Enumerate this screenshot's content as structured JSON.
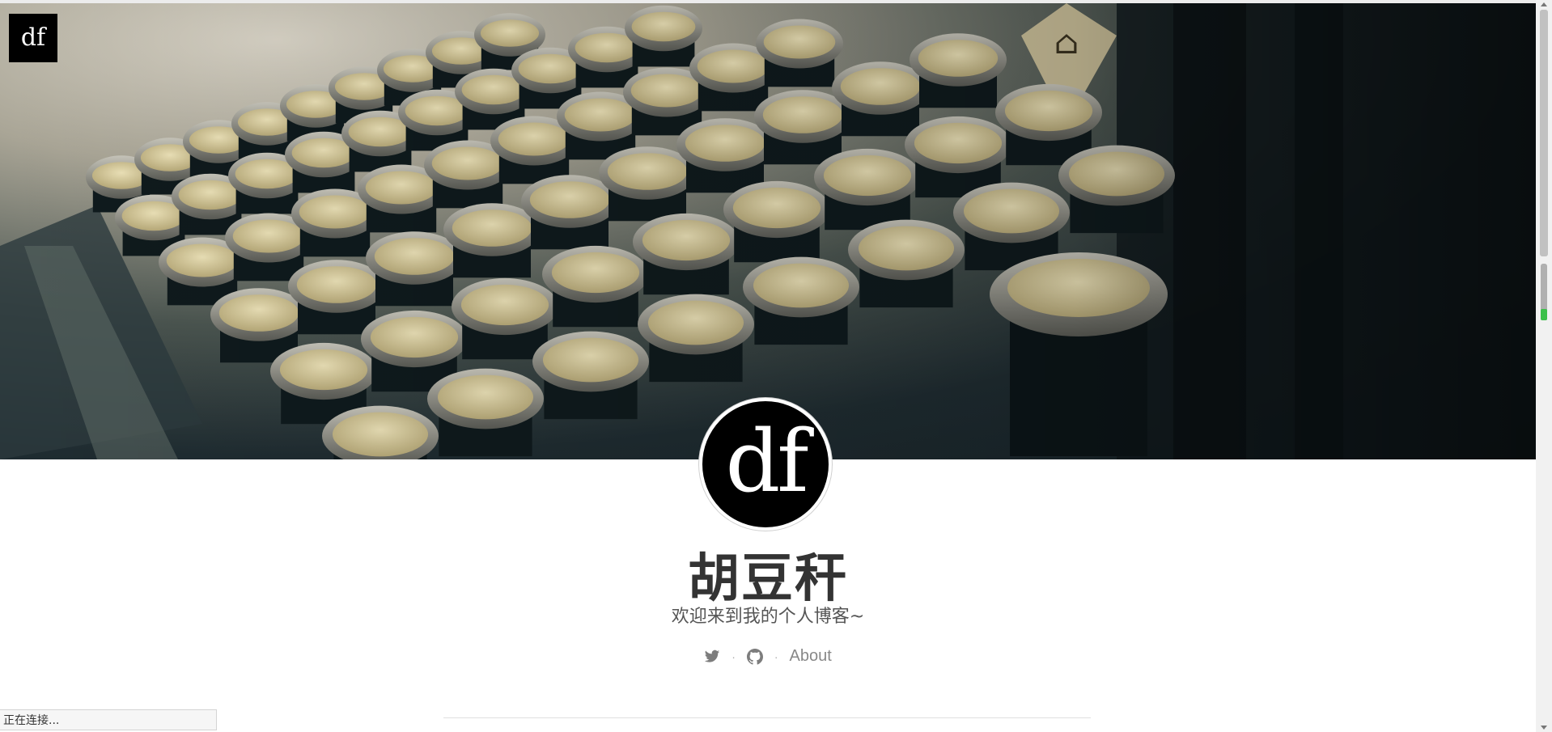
{
  "header": {
    "logo_text": "df"
  },
  "profile": {
    "avatar_text": "df",
    "name": "胡豆秆",
    "motto": "欢迎来到我的个人博客~"
  },
  "social": {
    "twitter_icon": "twitter-icon",
    "github_icon": "github-icon",
    "separator": "·",
    "about_label": "About"
  },
  "status_bar": {
    "text": "正在连接..."
  },
  "colors": {
    "hero_dark": "#1f2c31",
    "key_cap": "#d9cc9a",
    "key_ring": "#9a9a8e",
    "scroll_indicator": "#3cc04a"
  }
}
